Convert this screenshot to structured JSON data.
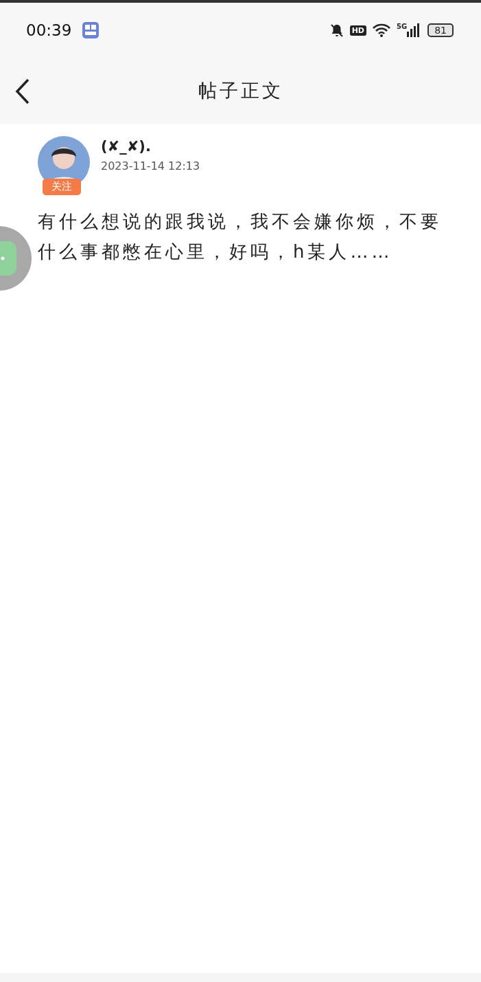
{
  "status_bar": {
    "time": "00:39",
    "network": "5G",
    "hd": "HD",
    "battery": "81"
  },
  "header": {
    "title": "帖子正文"
  },
  "post": {
    "author": "(✘_✘).",
    "time": "2023-11-14 12:13",
    "follow": "关注",
    "body": "有什么想说的跟我说，我不会嫌你烦，不要什么事都憋在心里，好吗，h某人……"
  }
}
